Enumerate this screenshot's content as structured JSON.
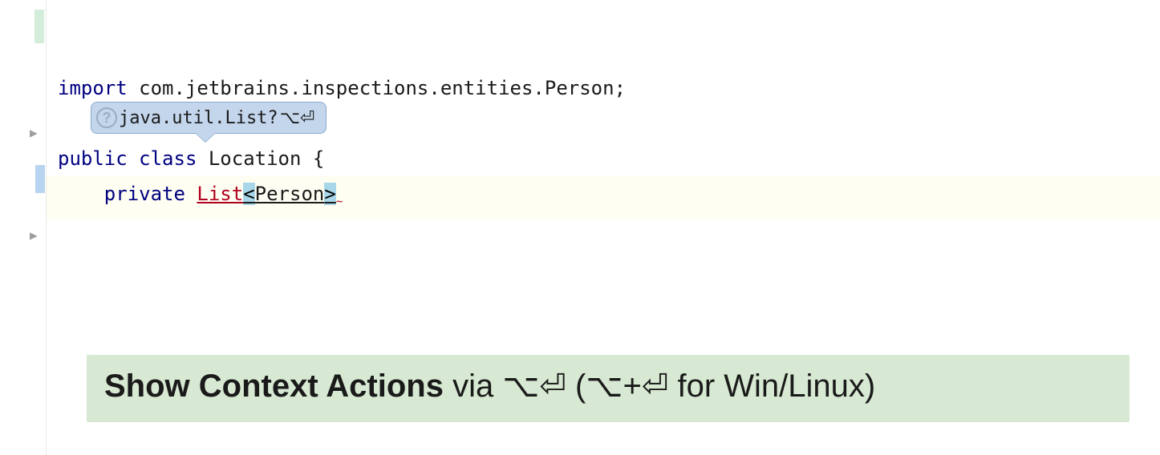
{
  "code": {
    "line1": {
      "keyword": "import",
      "path": " com.jetbrains.inspections.entities.Person;"
    },
    "line3": {
      "prefix_kw": "public",
      "class_kw": " class",
      "name": " Location {"
    },
    "line4": {
      "modifier": "private",
      "space": " ",
      "type_error": "List",
      "bracket_open": "<",
      "generic": "Person",
      "bracket_close": ">",
      "squiggle": "~"
    }
  },
  "tooltip": {
    "text": "java.util.List? ",
    "shortcut": "⌥⏎"
  },
  "hint": {
    "bold": "Show Context Actions",
    "via": " via ",
    "shortcut1": "⌥⏎",
    "paren_open": " (",
    "shortcut2": "⌥+⏎",
    "suffix": " for Win/Linux)"
  }
}
